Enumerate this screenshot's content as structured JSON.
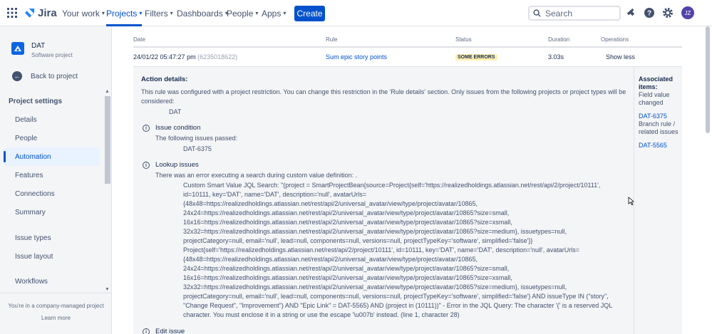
{
  "nav": {
    "logo": "Jira",
    "items": [
      {
        "label": "Your work",
        "active": false
      },
      {
        "label": "Projects",
        "active": true
      },
      {
        "label": "Filters",
        "active": false
      },
      {
        "label": "Dashboards",
        "active": false
      },
      {
        "label": "People",
        "active": false
      },
      {
        "label": "Apps",
        "active": false
      }
    ],
    "create": "Create",
    "search_placeholder": "Search",
    "avatar_initials": "JZ"
  },
  "sidebar": {
    "project_name": "DAT",
    "project_type": "Software project",
    "back": "Back to project",
    "section": "Project settings",
    "items": [
      "Details",
      "People",
      "Automation",
      "Features",
      "Connections",
      "Summary",
      "Issue types",
      "Issue layout",
      "Workflows"
    ],
    "selected": "Automation",
    "footer_note": "You're in a company-managed project",
    "footer_link": "Learn more"
  },
  "table": {
    "headers": {
      "date": "Date",
      "rule": "Rule",
      "status": "Status",
      "duration": "Duration",
      "operations": "Operations"
    },
    "row": {
      "date": "24/01/22 05:47:27 pm",
      "id": "(6235018622)",
      "rule": "Sum epic story points",
      "status": "SOME ERRORS",
      "duration": "3.03s",
      "operation": "Show less"
    }
  },
  "details": {
    "title": "Action details:",
    "restriction_text": "This rule was configured with a project restriction. You can change this restriction in the 'Rule details' section. Only issues from the following projects or project types will be considered:",
    "project": "DAT",
    "condition_title": "Issue condition",
    "condition_text": "The following issues passed:",
    "condition_issue": "DAT-6375",
    "lookup_title": "Lookup issues",
    "lookup_text": "There was an error executing a search during custom value definition: .",
    "jql_error": "Custom Smart Value JQL Search: \"(project = SmartProjectBean{source=Project{self='https://realizedholdings.atlassian.net/rest/api/2/project/10111',\nid=10111, key='DAT', name='DAT', description='null', avatarUrls=\n{48x48=https://realizedholdings.atlassian.net/rest/api/2/universal_avatar/view/type/project/avatar/10865,\n24x24=https://realizedholdings.atlassian.net/rest/api/2/universal_avatar/view/type/project/avatar/10865?size=small,\n16x16=https://realizedholdings.atlassian.net/rest/api/2/universal_avatar/view/type/project/avatar/10865?size=xsmall,\n32x32=https://realizedholdings.atlassian.net/rest/api/2/universal_avatar/view/type/project/avatar/10865?size=medium}, issuetypes=null,\nprojectCategory=null, email='null', lead=null, components=null, versions=null, projectTypeKey='software', simplified='false'}}\nProject{self='https://realizedholdings.atlassian.net/rest/api/2/project/10111', id=10111, key='DAT', name='DAT', description='null', avatarUrls=\n{48x48=https://realizedholdings.atlassian.net/rest/api/2/universal_avatar/view/type/project/avatar/10865,\n24x24=https://realizedholdings.atlassian.net/rest/api/2/universal_avatar/view/type/project/avatar/10865?size=small,\n16x16=https://realizedholdings.atlassian.net/rest/api/2/universal_avatar/view/type/project/avatar/10865?size=xsmall,\n32x32=https://realizedholdings.atlassian.net/rest/api/2/universal_avatar/view/type/project/avatar/10865?size=medium}, issuetypes=null,\nprojectCategory=null, email='null', lead=null, components=null, versions=null, projectTypeKey='software', simplified='false'} AND issueType IN (\"story\",\n\"Change Request\", \"Improvement\") AND \"Epic Link\" = DAT-5565) AND (project in (10111))\" - Error in the JQL Query: The character '{' is a reserved JQL\ncharacter. You must enclose it in a string or use the escape '\\u007b' instead. (line 1, character 28)",
    "edit_title": "Edit issue"
  },
  "associated": {
    "title": "Associated items:",
    "label1": "Field value changed",
    "key1": "DAT-6375",
    "label2": "Branch rule / related issues",
    "key2": "DAT-5565"
  },
  "colors": {
    "brand": "#0052cc",
    "lozenge": "#fff0b3",
    "sidebar_bg": "#f4f5f7"
  }
}
